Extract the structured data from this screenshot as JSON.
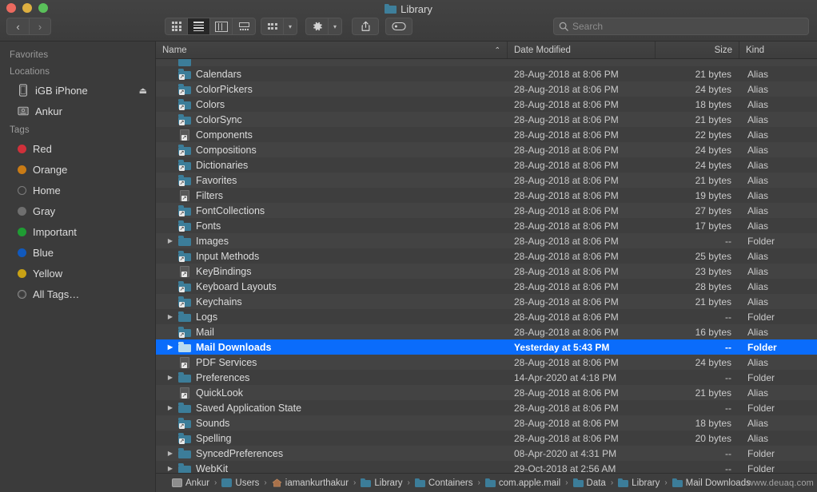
{
  "window": {
    "title": "Library",
    "title_icon": "folder-icon",
    "traffic_lights": [
      "close-button",
      "minimize-button",
      "zoom-button"
    ]
  },
  "toolbar": {
    "back_label": "‹",
    "forward_label": "›",
    "view_icon_label": "icon-view",
    "view_list_label": "list-view",
    "view_column_label": "column-view",
    "view_gallery_label": "gallery-view",
    "group_label": "group-by",
    "action_label": "action-gear",
    "share_label": "share",
    "tags_label": "tags",
    "active_view": "list-view"
  },
  "search": {
    "placeholder": "Search",
    "value": ""
  },
  "sidebar": {
    "sections": [
      {
        "header": "Favorites",
        "items": []
      },
      {
        "header": "Locations",
        "items": [
          {
            "label": "iGB iPhone",
            "icon": "iphone-icon",
            "eject": "⏏"
          },
          {
            "label": "Ankur",
            "icon": "disk-icon",
            "eject": ""
          }
        ]
      },
      {
        "header": "Tags",
        "items": [
          {
            "label": "Red",
            "color": "#d0303a"
          },
          {
            "label": "Orange",
            "color": "#c97b15"
          },
          {
            "label": "Home",
            "color": "hollow"
          },
          {
            "label": "Gray",
            "color": "#6f6f6f"
          },
          {
            "label": "Important",
            "color": "#1f9c33"
          },
          {
            "label": "Blue",
            "color": "#1159bd"
          },
          {
            "label": "Yellow",
            "color": "#c9a215"
          },
          {
            "label": "All Tags…",
            "color": "alltags"
          }
        ]
      }
    ]
  },
  "columns": {
    "name": "Name",
    "date_modified": "Date Modified",
    "size": "Size",
    "kind": "Kind",
    "sort_indicator": "⌃",
    "sorted_by": "Name"
  },
  "files": [
    {
      "name": "Calendars",
      "date": "28-Aug-2018 at 8:06 PM",
      "size": "21 bytes",
      "kind": "Alias",
      "icon": "alias-folder-icon",
      "expandable": false,
      "selected": false
    },
    {
      "name": "ColorPickers",
      "date": "28-Aug-2018 at 8:06 PM",
      "size": "24 bytes",
      "kind": "Alias",
      "icon": "alias-folder-icon",
      "expandable": false,
      "selected": false
    },
    {
      "name": "Colors",
      "date": "28-Aug-2018 at 8:06 PM",
      "size": "18 bytes",
      "kind": "Alias",
      "icon": "alias-folder-icon",
      "expandable": false,
      "selected": false
    },
    {
      "name": "ColorSync",
      "date": "28-Aug-2018 at 8:06 PM",
      "size": "21 bytes",
      "kind": "Alias",
      "icon": "alias-folder-icon",
      "expandable": false,
      "selected": false
    },
    {
      "name": "Components",
      "date": "28-Aug-2018 at 8:06 PM",
      "size": "22 bytes",
      "kind": "Alias",
      "icon": "alias-doc-icon",
      "expandable": false,
      "selected": false
    },
    {
      "name": "Compositions",
      "date": "28-Aug-2018 at 8:06 PM",
      "size": "24 bytes",
      "kind": "Alias",
      "icon": "alias-folder-icon",
      "expandable": false,
      "selected": false
    },
    {
      "name": "Dictionaries",
      "date": "28-Aug-2018 at 8:06 PM",
      "size": "24 bytes",
      "kind": "Alias",
      "icon": "alias-folder-icon",
      "expandable": false,
      "selected": false
    },
    {
      "name": "Favorites",
      "date": "28-Aug-2018 at 8:06 PM",
      "size": "21 bytes",
      "kind": "Alias",
      "icon": "alias-folder-icon",
      "expandable": false,
      "selected": false
    },
    {
      "name": "Filters",
      "date": "28-Aug-2018 at 8:06 PM",
      "size": "19 bytes",
      "kind": "Alias",
      "icon": "alias-doc-icon",
      "expandable": false,
      "selected": false
    },
    {
      "name": "FontCollections",
      "date": "28-Aug-2018 at 8:06 PM",
      "size": "27 bytes",
      "kind": "Alias",
      "icon": "alias-folder-icon",
      "expandable": false,
      "selected": false
    },
    {
      "name": "Fonts",
      "date": "28-Aug-2018 at 8:06 PM",
      "size": "17 bytes",
      "kind": "Alias",
      "icon": "alias-folder-icon",
      "expandable": false,
      "selected": false
    },
    {
      "name": "Images",
      "date": "28-Aug-2018 at 8:06 PM",
      "size": "--",
      "kind": "Folder",
      "icon": "folder-icon",
      "expandable": true,
      "selected": false
    },
    {
      "name": "Input Methods",
      "date": "28-Aug-2018 at 8:06 PM",
      "size": "25 bytes",
      "kind": "Alias",
      "icon": "alias-folder-icon",
      "expandable": false,
      "selected": false
    },
    {
      "name": "KeyBindings",
      "date": "28-Aug-2018 at 8:06 PM",
      "size": "23 bytes",
      "kind": "Alias",
      "icon": "alias-doc-icon",
      "expandable": false,
      "selected": false
    },
    {
      "name": "Keyboard Layouts",
      "date": "28-Aug-2018 at 8:06 PM",
      "size": "28 bytes",
      "kind": "Alias",
      "icon": "alias-folder-icon",
      "expandable": false,
      "selected": false
    },
    {
      "name": "Keychains",
      "date": "28-Aug-2018 at 8:06 PM",
      "size": "21 bytes",
      "kind": "Alias",
      "icon": "alias-folder-icon",
      "expandable": false,
      "selected": false
    },
    {
      "name": "Logs",
      "date": "28-Aug-2018 at 8:06 PM",
      "size": "--",
      "kind": "Folder",
      "icon": "folder-icon",
      "expandable": true,
      "selected": false
    },
    {
      "name": "Mail",
      "date": "28-Aug-2018 at 8:06 PM",
      "size": "16 bytes",
      "kind": "Alias",
      "icon": "alias-folder-icon",
      "expandable": false,
      "selected": false
    },
    {
      "name": "Mail Downloads",
      "date": "Yesterday at 5:43 PM",
      "size": "--",
      "kind": "Folder",
      "icon": "folder-icon-light",
      "expandable": true,
      "selected": true
    },
    {
      "name": "PDF Services",
      "date": "28-Aug-2018 at 8:06 PM",
      "size": "24 bytes",
      "kind": "Alias",
      "icon": "alias-doc-icon",
      "expandable": false,
      "selected": false
    },
    {
      "name": "Preferences",
      "date": "14-Apr-2020 at 4:18 PM",
      "size": "--",
      "kind": "Folder",
      "icon": "folder-icon",
      "expandable": true,
      "selected": false
    },
    {
      "name": "QuickLook",
      "date": "28-Aug-2018 at 8:06 PM",
      "size": "21 bytes",
      "kind": "Alias",
      "icon": "alias-doc-icon",
      "expandable": false,
      "selected": false
    },
    {
      "name": "Saved Application State",
      "date": "28-Aug-2018 at 8:06 PM",
      "size": "--",
      "kind": "Folder",
      "icon": "folder-icon",
      "expandable": true,
      "selected": false
    },
    {
      "name": "Sounds",
      "date": "28-Aug-2018 at 8:06 PM",
      "size": "18 bytes",
      "kind": "Alias",
      "icon": "alias-folder-icon",
      "expandable": false,
      "selected": false
    },
    {
      "name": "Spelling",
      "date": "28-Aug-2018 at 8:06 PM",
      "size": "20 bytes",
      "kind": "Alias",
      "icon": "alias-folder-icon",
      "expandable": false,
      "selected": false
    },
    {
      "name": "SyncedPreferences",
      "date": "08-Apr-2020 at 4:31 PM",
      "size": "--",
      "kind": "Folder",
      "icon": "folder-icon",
      "expandable": true,
      "selected": false
    },
    {
      "name": "WebKit",
      "date": "29-Oct-2018 at 2:56 AM",
      "size": "--",
      "kind": "Folder",
      "icon": "folder-icon",
      "expandable": true,
      "selected": false
    }
  ],
  "pathbar": {
    "crumbs": [
      {
        "label": "Ankur",
        "icon": "disk-icon"
      },
      {
        "label": "Users",
        "icon": "users-folder-icon"
      },
      {
        "label": "iamankurthakur",
        "icon": "home-icon"
      },
      {
        "label": "Library",
        "icon": "folder-icon"
      },
      {
        "label": "Containers",
        "icon": "folder-icon"
      },
      {
        "label": "com.apple.mail",
        "icon": "folder-icon"
      },
      {
        "label": "Data",
        "icon": "folder-icon"
      },
      {
        "label": "Library",
        "icon": "folder-icon"
      },
      {
        "label": "Mail Downloads",
        "icon": "folder-icon"
      }
    ],
    "separator": "›"
  },
  "watermark": "www.deuaq.com",
  "colors": {
    "selection_blue": "#0a6cfb",
    "folder_blue": "#3c7d99",
    "window_bg": "#3b3b3b",
    "row_odd": "#3e3e3e",
    "row_even": "#434343"
  }
}
